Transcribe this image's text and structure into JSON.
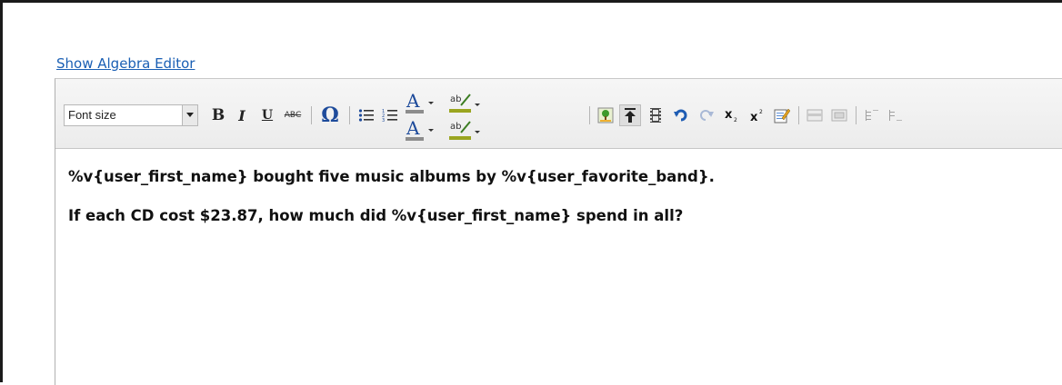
{
  "editor": {
    "algebra_link": "Show Algebra Editor",
    "font_size_label": "Font size",
    "toolbar": {
      "bold": "B",
      "italic": "I",
      "underline": "U",
      "strike": "ABC",
      "special_char": "Ω"
    },
    "content": {
      "line1": "%v{user_first_name} bought five music albums by %v{user_favorite_band}.",
      "line2": "If each CD cost $23.87, how much did %v{user_first_name} spend in all?"
    }
  },
  "colors": {
    "link": "#1a5fb4",
    "toolbar_bg": "#f0f0f0",
    "icon_blue": "#1e4b9b"
  },
  "icons": [
    "dropdown-arrow-icon",
    "bold-icon",
    "italic-icon",
    "underline-icon",
    "strikethrough-icon",
    "special-character-icon",
    "bullet-list-icon",
    "numbered-list-icon",
    "text-color-icon",
    "highlight-color-icon",
    "image-icon",
    "upload-icon",
    "media-icon",
    "undo-icon",
    "redo-icon",
    "subscript-icon",
    "superscript-icon",
    "edit-source-icon",
    "table-row-icon",
    "table-col-icon",
    "indent-icon",
    "outdent-icon"
  ]
}
